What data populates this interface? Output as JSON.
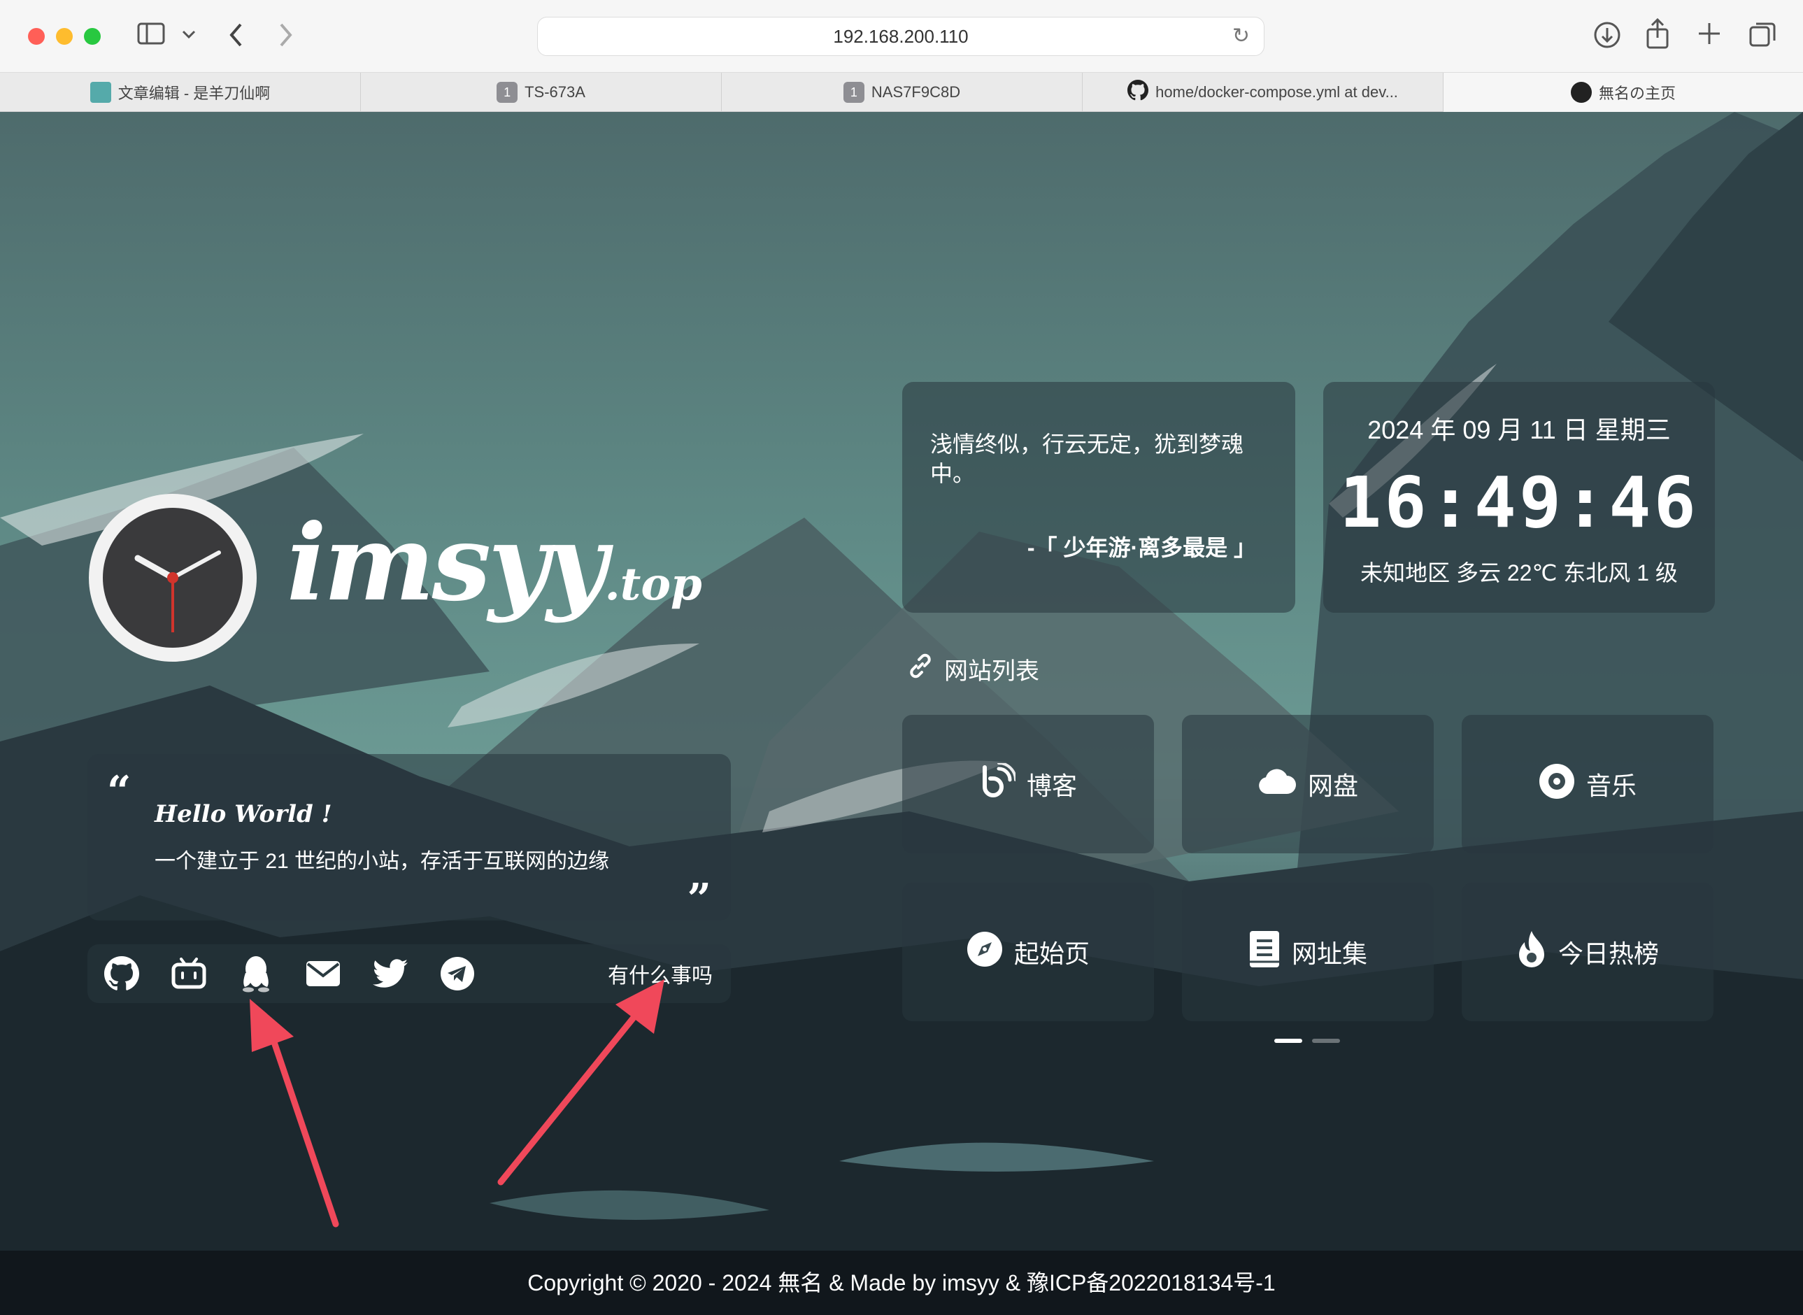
{
  "browser": {
    "address": "192.168.200.110",
    "tabs": [
      {
        "title": "文章编辑 - 是羊刀仙啊",
        "favicon": "1"
      },
      {
        "title": "TS-673A",
        "favicon": "1"
      },
      {
        "title": "NAS7F9C8D",
        "favicon": "1"
      },
      {
        "title": "home/docker-compose.yml at dev...",
        "favicon": "github"
      },
      {
        "title": "無名の主页",
        "favicon": "site"
      }
    ],
    "tab_badge": "1"
  },
  "brand": {
    "name": "imsyy",
    "suffix": ".top"
  },
  "intro": {
    "open_quote": "“",
    "close_quote": "”",
    "greeting": "Hello World !",
    "text": "一个建立于 21 世纪的小站，存活于互联网的边缘"
  },
  "social": {
    "icons": [
      "github-icon",
      "bilibili-icon",
      "qq-icon",
      "mail-icon",
      "twitter-icon",
      "telegram-icon"
    ],
    "hint": "有什么事吗"
  },
  "poem": {
    "text": "浅情终似，行云无定，犹到梦魂中。",
    "source": "-「 少年游·离多最是 」"
  },
  "clock": {
    "date": "2024 年 09 月 11 日 星期三",
    "time": "16:49:46",
    "weather": "未知地区 多云 22℃  东北风  1 级"
  },
  "sites": {
    "title": "网站列表",
    "items": [
      {
        "label": "博客",
        "icon": "blog-icon"
      },
      {
        "label": "网盘",
        "icon": "cloud-icon"
      },
      {
        "label": "音乐",
        "icon": "music-icon"
      },
      {
        "label": "起始页",
        "icon": "compass-icon"
      },
      {
        "label": "网址集",
        "icon": "book-icon"
      },
      {
        "label": "今日热榜",
        "icon": "fire-icon"
      }
    ],
    "page_indicator": {
      "pages": 2,
      "current": 1
    }
  },
  "footer": {
    "text": "Copyright  © 2020 - 2024 無名 & Made by imsyy & 豫ICP备2022018134号-1"
  },
  "colors": {
    "accent_arrow": "#f0485a",
    "card_bg": "rgba(40,55,62,0.55)"
  }
}
